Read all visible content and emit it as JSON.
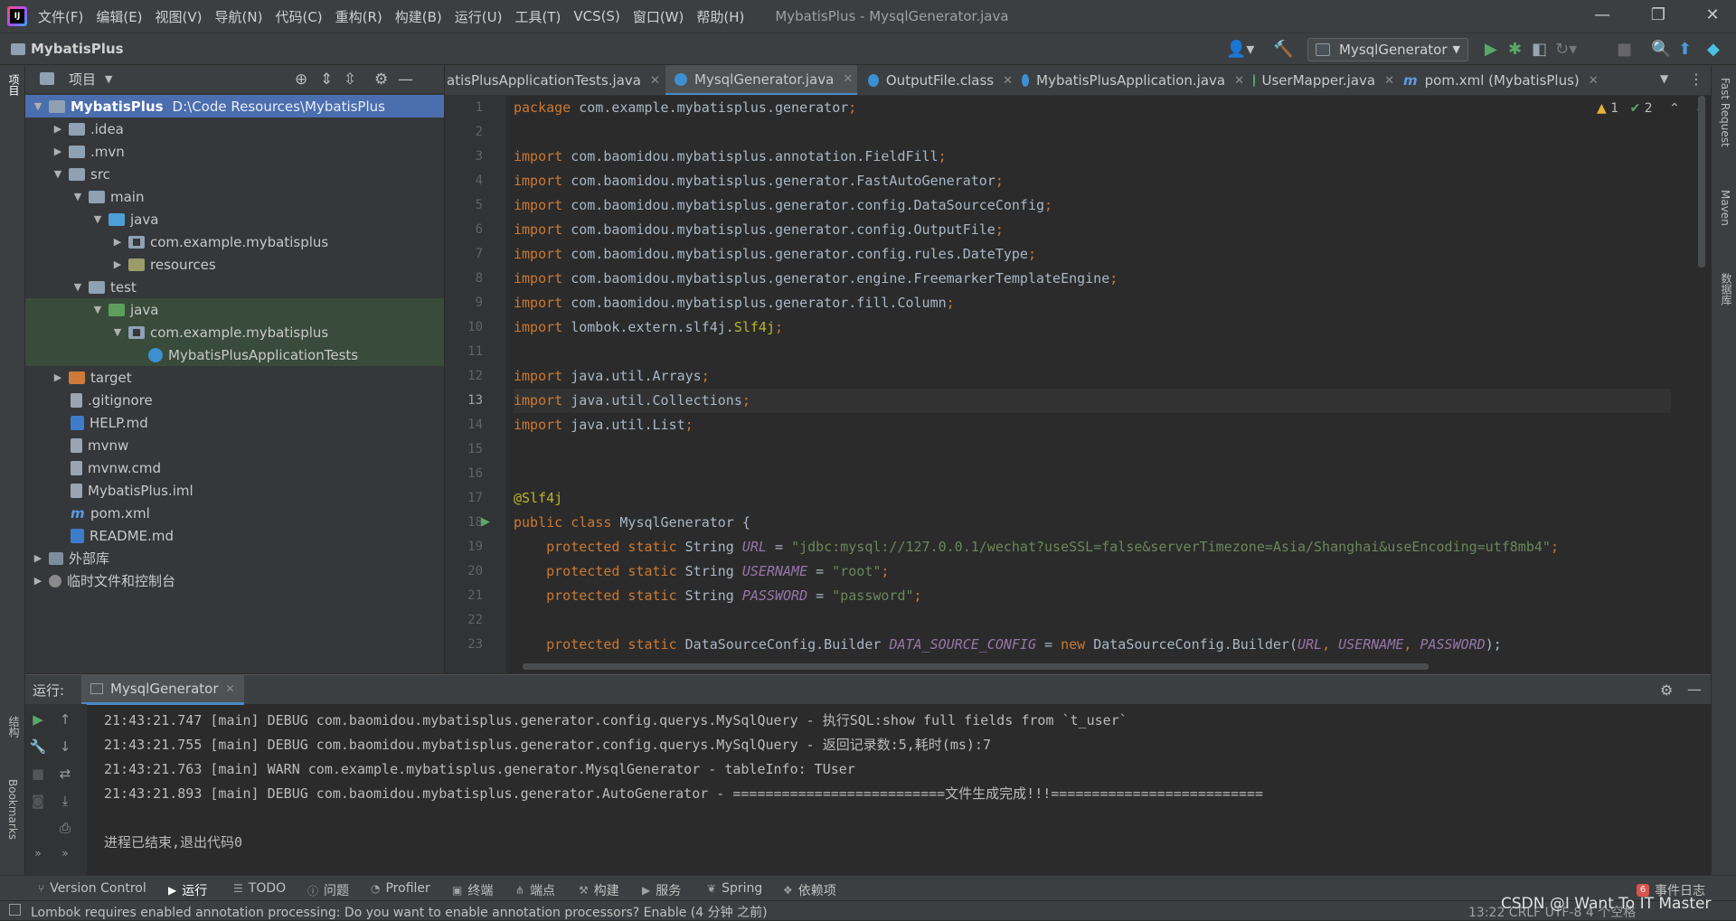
{
  "menubar": {
    "items": [
      "文件(F)",
      "编辑(E)",
      "视图(V)",
      "导航(N)",
      "代码(C)",
      "重构(R)",
      "构建(B)",
      "运行(U)",
      "工具(T)",
      "VCS(S)",
      "窗口(W)",
      "帮助(H)"
    ],
    "window_title": "MybatisPlus - MysqlGenerator.java"
  },
  "navbar": {
    "project": "MybatisPlus",
    "run_config": "MysqlGenerator"
  },
  "left_strip": {
    "project_label": "项目",
    "structure_label": "结构",
    "bookmarks_label": "Bookmarks"
  },
  "right_strip": {
    "fast_request": "Fast Request",
    "maven": "Maven",
    "database": "数据库"
  },
  "project_panel": {
    "title": "项目",
    "tree": [
      {
        "label": "MybatisPlus",
        "extra": "D:\\Code Resources\\MybatisPlus"
      },
      {
        "label": ".idea"
      },
      {
        "label": ".mvn"
      },
      {
        "label": "src"
      },
      {
        "label": "main"
      },
      {
        "label": "java"
      },
      {
        "label": "com.example.mybatisplus"
      },
      {
        "label": "resources"
      },
      {
        "label": "test"
      },
      {
        "label": "java"
      },
      {
        "label": "com.example.mybatisplus"
      },
      {
        "label": "MybatisPlusApplicationTests"
      },
      {
        "label": "target"
      },
      {
        "label": ".gitignore"
      },
      {
        "label": "HELP.md"
      },
      {
        "label": "mvnw"
      },
      {
        "label": "mvnw.cmd"
      },
      {
        "label": "MybatisPlus.iml"
      },
      {
        "label": "pom.xml"
      },
      {
        "label": "README.md"
      },
      {
        "label": "外部库"
      },
      {
        "label": "临时文件和控制台"
      }
    ]
  },
  "editor": {
    "tabs": [
      {
        "label": "atisPlusApplicationTests.java"
      },
      {
        "label": "MysqlGenerator.java"
      },
      {
        "label": "OutputFile.class"
      },
      {
        "label": "MybatisPlusApplication.java"
      },
      {
        "label": "UserMapper.java"
      },
      {
        "label": "pom.xml (MybatisPlus)"
      }
    ],
    "line_numbers": [
      "1",
      "2",
      "3",
      "4",
      "5",
      "6",
      "7",
      "8",
      "9",
      "10",
      "11",
      "12",
      "13",
      "14",
      "15",
      "16",
      "17",
      "18",
      "19",
      "20",
      "21",
      "22",
      "23"
    ],
    "inspections": {
      "warnings": "1",
      "weak_warnings": "2"
    },
    "code": {
      "l1a": "package",
      "l1b": " com.example.mybatisplus.generator",
      "l1c": ";",
      "import_kw": "import",
      "l3": " com.baomidou.mybatisplus.annotation.FieldFill",
      "l4": " com.baomidou.mybatisplus.generator.FastAutoGenerator",
      "l5": " com.baomidou.mybatisplus.generator.config.DataSourceConfig",
      "l6": " com.baomidou.mybatisplus.generator.config.OutputFile",
      "l7": " com.baomidou.mybatisplus.generator.config.rules.DateType",
      "l8": " com.baomidou.mybatisplus.generator.engine.FreemarkerTemplateEngine",
      "l9": " com.baomidou.mybatisplus.generator.fill.Column",
      "l10a": " lombok.extern.slf4j.",
      "l10b": "Slf4j",
      "l12": " java.util.Arrays",
      "l13": " java.util.Collections",
      "l14": " java.util.List",
      "semi": ";",
      "l17": "@Slf4j",
      "l18a": "public class",
      "l18b": " MysqlGenerator {",
      "prot": "    protected static",
      "string_t": " String ",
      "l19f": "URL",
      "l19s": "\"jdbc:mysql://127.0.0.1/wechat?useSSL=false&serverTimezone=Asia/Shanghai&useEncoding=utf8mb4\"",
      "l20f": "USERNAME",
      "l20s": "\"root\"",
      "l21f": "PASSWORD",
      "l21s": "\"password\"",
      "eq": " = ",
      "l23a": " DataSourceConfig.Builder ",
      "l23f": "DATA_SOURCE_CONFIG",
      "l23b": " = ",
      "l23n": "new",
      "l23c": " DataSourceConfig.Builder(",
      "l23p1": "URL",
      "l23comma": ", ",
      "l23p2": "USERNAME",
      "l23p3": "PASSWORD",
      "l23end": ");"
    }
  },
  "run_panel": {
    "label": "运行:",
    "tab": "MysqlGenerator",
    "console": [
      "21:43:21.747 [main] DEBUG com.baomidou.mybatisplus.generator.config.querys.MySqlQuery - 执行SQL:show full fields from `t_user`",
      "21:43:21.755 [main] DEBUG com.baomidou.mybatisplus.generator.config.querys.MySqlQuery - 返回记录数:5,耗时(ms):7",
      "21:43:21.763 [main] WARN com.example.mybatisplus.generator.MysqlGenerator - tableInfo: TUser",
      "21:43:21.893 [main] DEBUG com.baomidou.mybatisplus.generator.AutoGenerator - ==========================文件生成完成!!!==========================",
      "",
      "进程已结束,退出代码0"
    ]
  },
  "bottom_tools": {
    "items": [
      "Version Control",
      "运行",
      "TODO",
      "问题",
      "Profiler",
      "终端",
      "端点",
      "构建",
      "服务",
      "Spring",
      "依赖项"
    ],
    "event_log": "事件日志",
    "event_count": "6"
  },
  "status_bar": {
    "message": "Lombok requires enabled annotation processing: Do you want to enable annotation processors? Enable (4 分钟 之前)",
    "right": "13:22   CRLF   UTF-8   4 个空格",
    "watermark": "CSDN @I Want To IT Master"
  }
}
